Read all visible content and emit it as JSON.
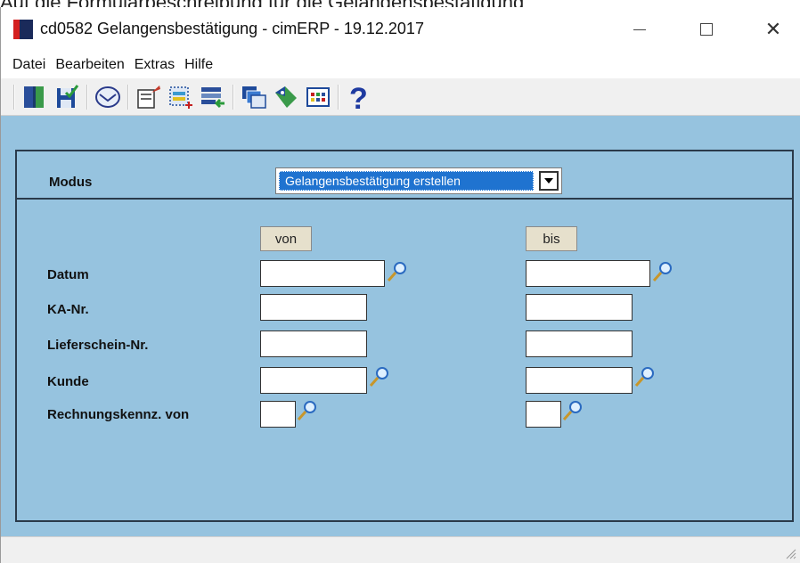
{
  "cropped_top_text": "Auf die Formularbeschreibung für die Gelangensbestätigung",
  "window": {
    "title": "cd0582 Gelangensbestätigung - cimERP - 19.12.2017",
    "minimize_symbol": "—",
    "close_symbol": "✕"
  },
  "menu": {
    "items": [
      "Datei",
      "Bearbeiten",
      "Extras",
      "Hilfe"
    ]
  },
  "toolbar": {
    "buttons": [
      "exit-icon",
      "save-icon",
      "mail-icon",
      "edit-form-icon",
      "new-record-icon",
      "import-icon",
      "windows-icon",
      "tag-icon",
      "grid-icon",
      "help-icon"
    ]
  },
  "form": {
    "modus_label": "Modus",
    "modus_value": "Gelangensbestätigung erstellen",
    "from_label": "von",
    "to_label": "bis",
    "rows": [
      {
        "label": "Datum",
        "from_value": "",
        "to_value": ""
      },
      {
        "label": "KA-Nr.",
        "from_value": "",
        "to_value": ""
      },
      {
        "label": "Lieferschein-Nr.",
        "from_value": "",
        "to_value": ""
      },
      {
        "label": "Kunde",
        "from_value": "",
        "to_value": ""
      },
      {
        "label": "Rechnungskennz. von",
        "from_value": "",
        "to_value": ""
      }
    ]
  },
  "colors": {
    "content_bg": "#96c3df",
    "selection_bg": "#1f73d0",
    "header_button_bg": "#e6e0cc"
  }
}
